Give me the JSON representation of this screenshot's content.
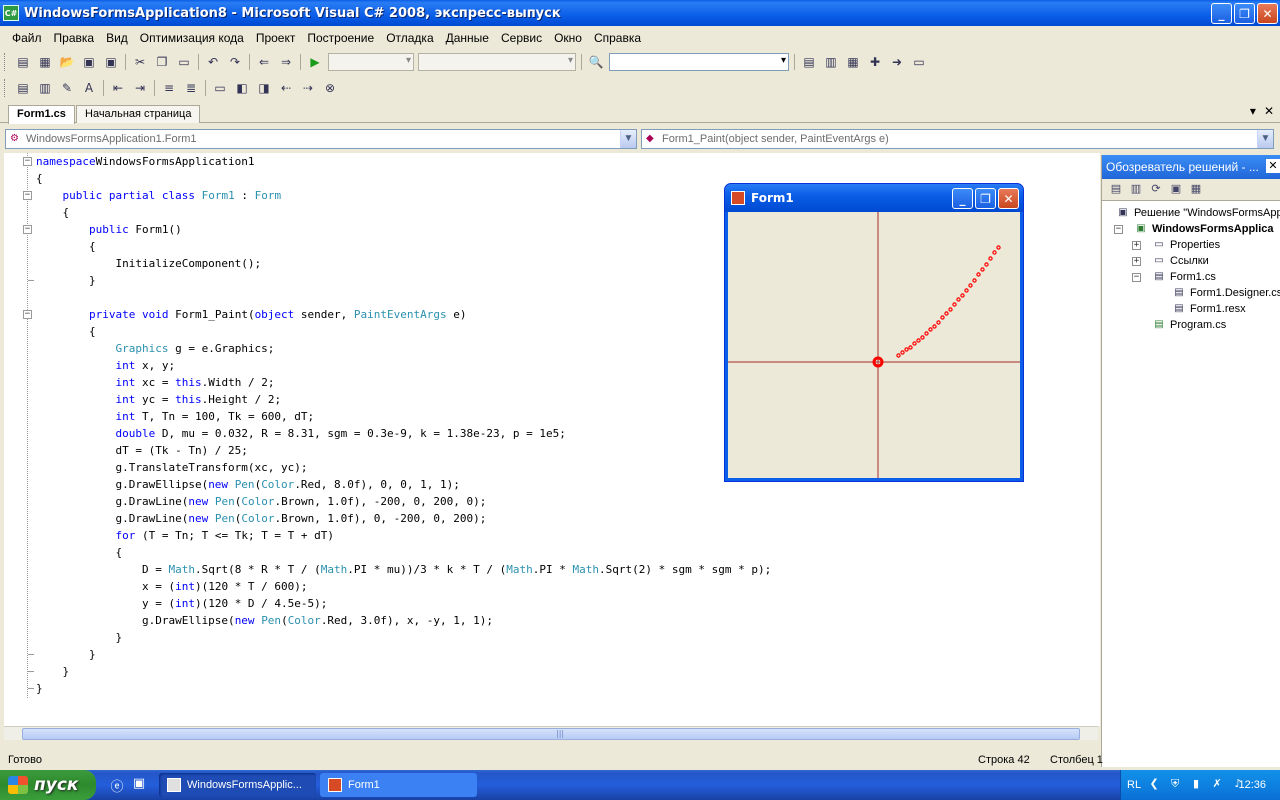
{
  "window": {
    "icon_label": "C#",
    "title": "WindowsFormsApplication8 - Microsoft Visual C# 2008, экспресс-выпуск",
    "minimize": "_",
    "maximize": "❐",
    "close": "✕"
  },
  "menu": [
    "Файл",
    "Правка",
    "Вид",
    "Оптимизация кода",
    "Проект",
    "Построение",
    "Отладка",
    "Данные",
    "Сервис",
    "Окно",
    "Справка"
  ],
  "doc_tabs": {
    "active": "Form1.cs",
    "inactive": "Начальная страница",
    "dropdown": "▾",
    "close": "✕"
  },
  "nav": {
    "class_combo": "WindowsFormsApplication1.Form1",
    "member_combo": "Form1_Paint(object sender, PaintEventArgs e)"
  },
  "code_lines": [
    [
      [
        "kw",
        "namespace"
      ],
      [
        "",
        "WindowsFormsApplication1"
      ]
    ],
    [
      [
        "",
        "{"
      ]
    ],
    [
      [
        "",
        "    "
      ],
      [
        "kw",
        "public partial class"
      ],
      [
        "",
        ""
      ],
      [
        "ty",
        "Form1"
      ],
      [
        "",
        " : "
      ],
      [
        "ty",
        "Form"
      ]
    ],
    [
      [
        "",
        "    {"
      ]
    ],
    [
      [
        "",
        "        "
      ],
      [
        "kw",
        "public"
      ],
      [
        "",
        " Form1()"
      ]
    ],
    [
      [
        "",
        "        {"
      ]
    ],
    [
      [
        "",
        "            InitializeComponent();"
      ]
    ],
    [
      [
        "",
        "        }"
      ]
    ],
    [
      [
        "",
        ""
      ]
    ],
    [
      [
        "",
        "        "
      ],
      [
        "kw",
        "private void"
      ],
      [
        "",
        " Form1_Paint("
      ],
      [
        "kw",
        "object"
      ],
      [
        "",
        " sender, "
      ],
      [
        "ty",
        "PaintEventArgs"
      ],
      [
        "",
        " e)"
      ]
    ],
    [
      [
        "",
        "        {"
      ]
    ],
    [
      [
        "",
        "            "
      ],
      [
        "ty",
        "Graphics"
      ],
      [
        "",
        " g = e.Graphics;"
      ]
    ],
    [
      [
        "",
        "            "
      ],
      [
        "kw",
        "int"
      ],
      [
        "",
        " x, y;"
      ]
    ],
    [
      [
        "",
        "            "
      ],
      [
        "kw",
        "int"
      ],
      [
        "",
        " xc = "
      ],
      [
        "kw",
        "this"
      ],
      [
        "",
        ".Width / 2;"
      ]
    ],
    [
      [
        "",
        "            "
      ],
      [
        "kw",
        "int"
      ],
      [
        "",
        " yc = "
      ],
      [
        "kw",
        "this"
      ],
      [
        "",
        ".Height / 2;"
      ]
    ],
    [
      [
        "",
        "            "
      ],
      [
        "kw",
        "int"
      ],
      [
        "",
        " T, Tn = 100, Tk = 600, dT;"
      ]
    ],
    [
      [
        "",
        "            "
      ],
      [
        "kw",
        "double"
      ],
      [
        "",
        " D, mu = 0.032, R = 8.31, sgm = 0.3e-9, k = 1.38e-23, p = 1e5;"
      ]
    ],
    [
      [
        "",
        "            dT = (Tk - Tn) / 25;"
      ]
    ],
    [
      [
        "",
        "            g.TranslateTransform(xc, yc);"
      ]
    ],
    [
      [
        "",
        "            g.DrawEllipse("
      ],
      [
        "kw",
        "new"
      ],
      [
        "",
        " "
      ],
      [
        "ty",
        "Pen"
      ],
      [
        "",
        "("
      ],
      [
        "ty",
        "Color"
      ],
      [
        "",
        ".Red, 8.0f), 0, 0, 1, 1);"
      ]
    ],
    [
      [
        "",
        "            g.DrawLine("
      ],
      [
        "kw",
        "new"
      ],
      [
        "",
        " "
      ],
      [
        "ty",
        "Pen"
      ],
      [
        "",
        "("
      ],
      [
        "ty",
        "Color"
      ],
      [
        "",
        ".Brown, 1.0f), -200, 0, 200, 0);"
      ]
    ],
    [
      [
        "",
        "            g.DrawLine("
      ],
      [
        "kw",
        "new"
      ],
      [
        "",
        " "
      ],
      [
        "ty",
        "Pen"
      ],
      [
        "",
        "("
      ],
      [
        "ty",
        "Color"
      ],
      [
        "",
        ".Brown, 1.0f), 0, -200, 0, 200);"
      ]
    ],
    [
      [
        "",
        "            "
      ],
      [
        "kw",
        "for"
      ],
      [
        "",
        " (T = Tn; T <= Tk; T = T + dT)"
      ]
    ],
    [
      [
        "",
        "            {"
      ]
    ],
    [
      [
        "",
        "                D = "
      ],
      [
        "ty",
        "Math"
      ],
      [
        "",
        ".Sqrt(8 * R * T / ("
      ],
      [
        "ty",
        "Math"
      ],
      [
        "",
        ".PI * mu))/3 * k * T / ("
      ],
      [
        "ty",
        "Math"
      ],
      [
        "",
        ".PI * "
      ],
      [
        "ty",
        "Math"
      ],
      [
        "",
        ".Sqrt(2) * sgm * sgm * p);"
      ]
    ],
    [
      [
        "",
        "                x = ("
      ],
      [
        "kw",
        "int"
      ],
      [
        "",
        ")(120 * T / 600);"
      ]
    ],
    [
      [
        "",
        "                y = ("
      ],
      [
        "kw",
        "int"
      ],
      [
        "",
        ")(120 * D / 4.5e-5);"
      ]
    ],
    [
      [
        "",
        "                g.DrawEllipse("
      ],
      [
        "kw",
        "new"
      ],
      [
        "",
        " "
      ],
      [
        "ty",
        "Pen"
      ],
      [
        "",
        "("
      ],
      [
        "ty",
        "Color"
      ],
      [
        "",
        ".Red, 3.0f), x, -y, 1, 1);"
      ]
    ],
    [
      [
        "",
        "            }"
      ]
    ],
    [
      [
        "",
        "        }"
      ]
    ],
    [
      [
        "",
        "    }"
      ]
    ],
    [
      [
        "",
        "}"
      ]
    ]
  ],
  "solution_explorer": {
    "title": "Обозреватель решений - ...",
    "close": "✕",
    "items": [
      {
        "label": "Решение \"WindowsFormsAppl",
        "icon": "solution-icon"
      },
      {
        "label": "WindowsFormsApplica",
        "icon": "project-icon"
      },
      {
        "label": "Properties",
        "icon": "properties-folder-icon"
      },
      {
        "label": "Ссылки",
        "icon": "references-folder-icon"
      },
      {
        "label": "Form1.cs",
        "icon": "form-icon"
      },
      {
        "label": "Form1.Designer.cs",
        "icon": "cs-file-icon"
      },
      {
        "label": "Form1.resx",
        "icon": "resx-file-icon"
      },
      {
        "label": "Program.cs",
        "icon": "cs-file-icon"
      }
    ]
  },
  "form1": {
    "title": "Form1",
    "axis_color": "#a52a2a",
    "point_color": "#ff0000"
  },
  "status": {
    "main": "Готово",
    "line": "Строка 42",
    "column": "Столбец 1"
  },
  "taskbar": {
    "start": "пуск",
    "items": [
      "WindowsFormsApplic...",
      "Form1"
    ],
    "lang": "RL",
    "time": "12:36"
  }
}
